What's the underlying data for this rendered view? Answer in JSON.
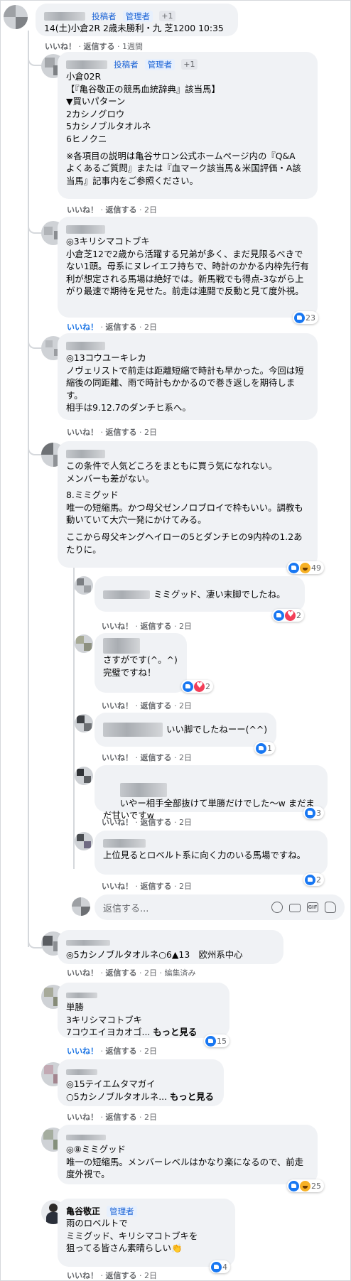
{
  "labels": {
    "like": "いいね！",
    "reply": "返信する",
    "edited": "編集済み",
    "see_more": "もっと見る"
  },
  "top": {
    "badge_poster": "投稿者",
    "badge_admin": "管理者",
    "badge_more": "+1",
    "text": "14(土)小倉2R 2歳未勝利・九 芝1200 10:35",
    "time": "1週間"
  },
  "comments": [
    {
      "badge_poster": "投稿者",
      "badge_admin": "管理者",
      "badge_more": "+1",
      "text": "小倉02R\n【『亀谷敬正の競馬血統辞典』該当馬】\n▼買いパターン\n2カシノグロウ\n5カシノブルタオルネ\n6ヒノクニ",
      "note": "※各項目の説明は亀谷サロン公式ホームページ内の『Q&A　よくあるご質問』または『血マーク該当馬＆米国評価・A該当馬』記事内をご参照ください。",
      "time": "2日"
    },
    {
      "text": "◎3キリシマコトブキ\n小倉芝12で2歳から活躍する兄弟が多く、まだ見限るべきでない1頭。母系にヌレイエフ持ちで、時計のかかる内枠先行有利が想定される馬場は絶好では。新馬戦でも得点-3ながら上がり最速で期待を見せた。前走は連闘で反動と見て度外視。",
      "time": "2日",
      "reactions": "23"
    },
    {
      "text": "◎13コウユーキレカ\nノヴェリストで前走は距離短縮で時計も早かった。今回は短縮後の同距離、雨で時計もかかるので巻き返しを期待します。\n相手は9.12.7のダンチヒ系へ。",
      "time": "2日"
    },
    {
      "text": "この条件で人気どころをまともに買う気になれない。\nメンバーも差がない。",
      "text2": "8.ミミグッド\n唯一の短縮馬。かつ母父ゼンノロブロイで枠もいい。調教も動いていて大穴一発にかけてみる。",
      "text3": "ここから母父キングヘイローの5とダンチヒの9内枠の1.2あたりに。",
      "time": "2日",
      "reactions": "49"
    }
  ],
  "replies": [
    {
      "text": "ミミグッド、凄い末脚でしたね。",
      "time": "2日",
      "reactions": "2"
    },
    {
      "text": "さすがです(^。^)\n完璧ですね！",
      "time": "2日",
      "reactions": "2"
    },
    {
      "text": "いい脚でしたねーー(^^)",
      "time": "2日",
      "reactions": "1"
    },
    {
      "text": "いやー相手全部抜けて単勝だけでした～w まだまだ甘いですw",
      "time": "2日",
      "reactions": "3"
    },
    {
      "text": "上位見るとロベルト系に向く力のいる馬場ですね。",
      "time": "2日",
      "reactions": "2"
    }
  ],
  "reply_box": {
    "placeholder": "返信する..."
  },
  "bottom": [
    {
      "text": "◎5カシノブルタオルネ○6▲13　欧州系中心",
      "time": "2日"
    },
    {
      "text": "単勝\n3キリシマコトブキ\n7コウエイヨカオゴ... ",
      "time": "2日",
      "reactions": "15"
    },
    {
      "text": "◎15テイエムタマガイ\n○5カシノブルタオルネ... ",
      "time": "2日"
    },
    {
      "text": "◎⑧ミミグッド\n唯一の短縮馬。メンバーレベルはかなり楽になるので、前走度外視で。",
      "time": "2日",
      "reactions": "25"
    },
    {
      "name": "亀谷敬正",
      "badge_admin": "管理者",
      "text": "雨のロベルトで\nミミグッド、キリシマコトブキを\n狙ってる皆さん素晴らしい👏",
      "time": "2日",
      "reactions": "4"
    }
  ],
  "colors": {
    "link": "#1b74e4",
    "bubble": "#f0f2f5",
    "meta": "#65676b"
  },
  "icons": [
    "like-reaction-icon",
    "haha-reaction-icon",
    "love-reaction-icon",
    "emoji-icon",
    "camera-icon",
    "gif-icon",
    "sticker-icon"
  ]
}
